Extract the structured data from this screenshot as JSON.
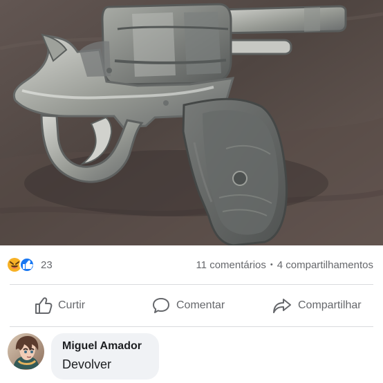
{
  "post": {
    "reactions": {
      "icons": [
        "haha-reaction-icon",
        "like-reaction-icon"
      ],
      "count": "23"
    },
    "engagement": {
      "comments": "11 comentários",
      "separator": "•",
      "shares": "4 compartilhamentos"
    },
    "actions": {
      "like_label": "Curtir",
      "comment_label": "Comentar",
      "share_label": "Compartilhar"
    },
    "comment": {
      "author": "Miguel Amador",
      "text": "Devolver"
    }
  },
  "colors": {
    "text_secondary": "#65676b",
    "divider": "#d9dadd",
    "comment_bubble": "#f0f2f5",
    "like_blue": "#1877f2",
    "haha_yellow": "#f7b125"
  }
}
